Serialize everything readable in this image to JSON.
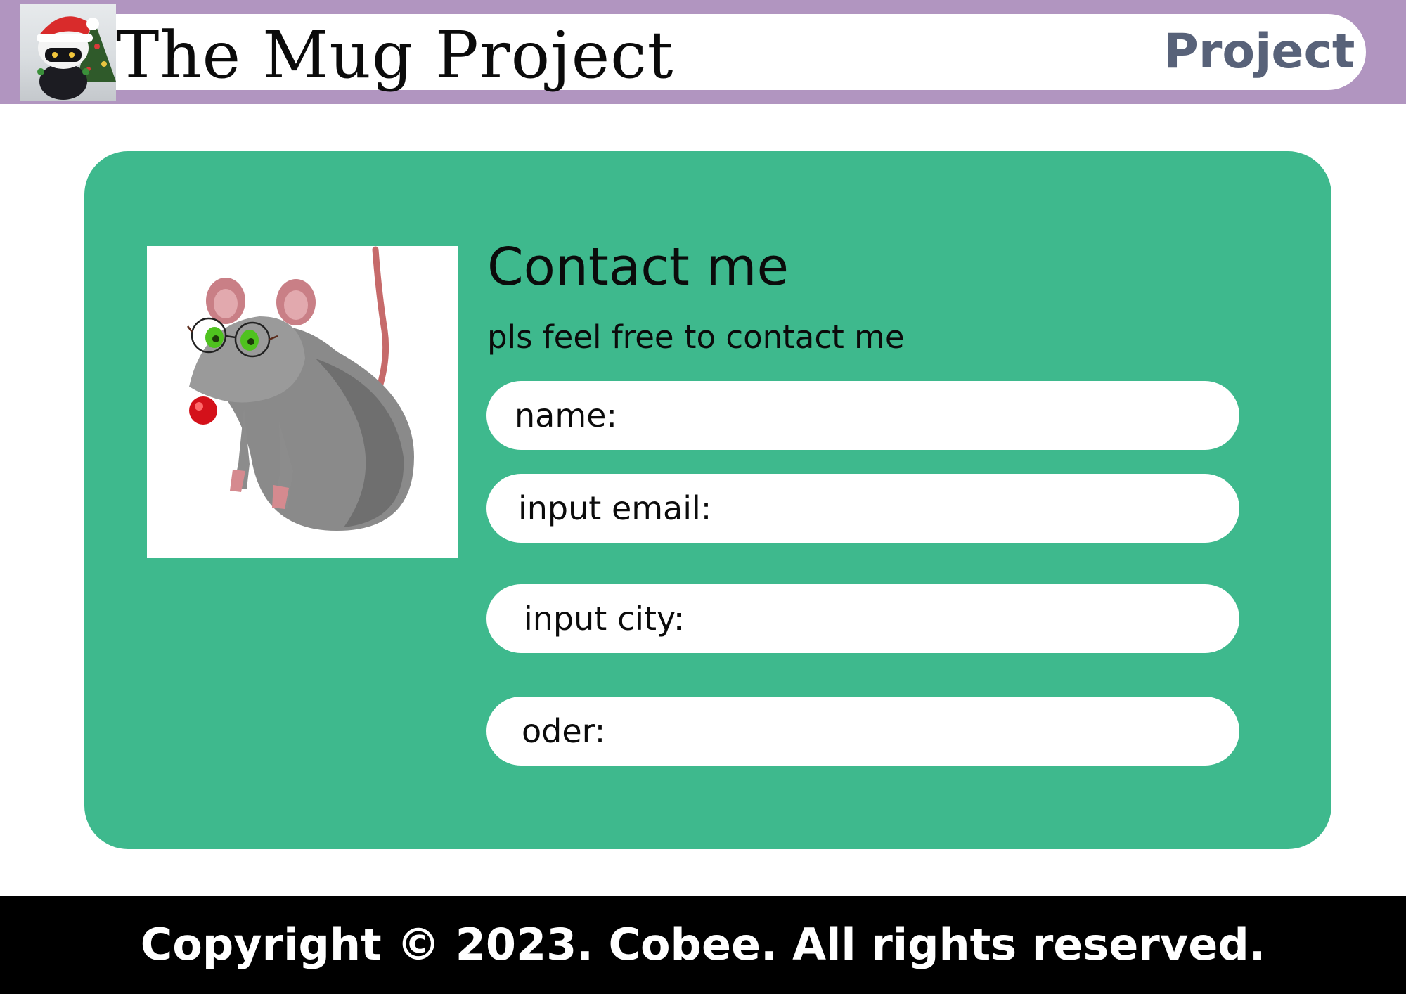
{
  "header": {
    "logo_icon": "mascot-with-santa-hat-logo",
    "title": "The Mug Project",
    "nav_project_label": "Project"
  },
  "contact": {
    "image_icon": "rat-with-glasses-and-red-nose-illustration",
    "heading": "Contact me",
    "subtitle": "pls feel free to contact me",
    "fields": [
      {
        "label": "name:"
      },
      {
        "label": "input email:"
      },
      {
        "label": "input city:"
      },
      {
        "label": "oder:"
      }
    ]
  },
  "footer": {
    "copyright": "Copyright © 2023. Cobee. All rights reserved."
  },
  "colors": {
    "header_bg": "#b195c0",
    "nav_text": "#586279",
    "card_bg": "#3eb98d",
    "footer_bg": "#000000",
    "text": "#0b0b0b"
  }
}
